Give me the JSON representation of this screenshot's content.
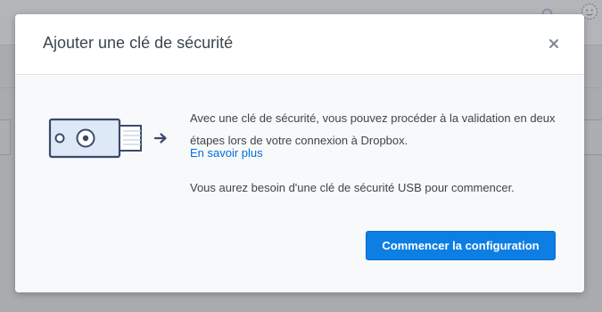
{
  "modal": {
    "title": "Ajouter une clé de sécurité",
    "description": "Avec une clé de sécurité, vous pouvez procéder à la validation en deux étapes lors de votre connexion à Dropbox.",
    "learn_more": "En savoir plus",
    "note": "Vous aurez besoin d'une clé de sécurité USB pour commencer.",
    "primary_button": "Commencer la configuration"
  },
  "icons": {
    "close": "close-icon",
    "illustration": "usb-security-key-illustration",
    "arrow": "arrow-right-icon",
    "search": "search-icon",
    "avatar": "avatar"
  },
  "colors": {
    "accent": "#0d7ee3",
    "link": "#0070e0",
    "text": "#3d464d",
    "illustration_stroke": "#3b4a6b",
    "illustration_fill": "#dde9f7"
  }
}
